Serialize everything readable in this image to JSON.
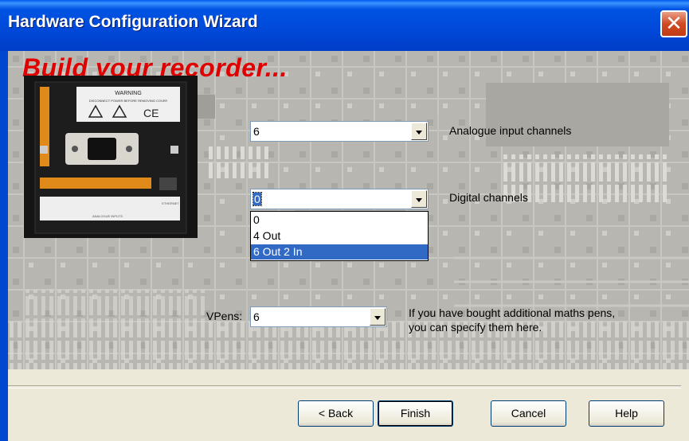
{
  "window": {
    "title": "Hardware Configuration Wizard",
    "close_glyph": "✕"
  },
  "heading": "Build your recorder...",
  "photo": {
    "warning_title": "WARNING",
    "warning_text": "DISCONNECT POWER BEFORE REMOVING COVER",
    "ce_mark": "CE",
    "bottom_label": "ANALOGUE INPUTS",
    "ethernet_label": "ETHERNET"
  },
  "analogue": {
    "value": "6",
    "label": "Analogue input channels"
  },
  "digital": {
    "value": "0",
    "label": "Digital channels",
    "options": [
      "0",
      "4 Out",
      "6 Out 2 In"
    ],
    "highlighted": "6 Out 2 In"
  },
  "vpens": {
    "prefix": "VPens:",
    "value": "6",
    "help_line1": "If you have bought additional maths pens,",
    "help_line2": "you can specify them here."
  },
  "buttons": {
    "back": "< Back",
    "finish": "Finish",
    "cancel": "Cancel",
    "help": "Help"
  },
  "colors": {
    "heading": "#e00000",
    "title_bar": "#0054e3",
    "selection": "#316ac5"
  }
}
